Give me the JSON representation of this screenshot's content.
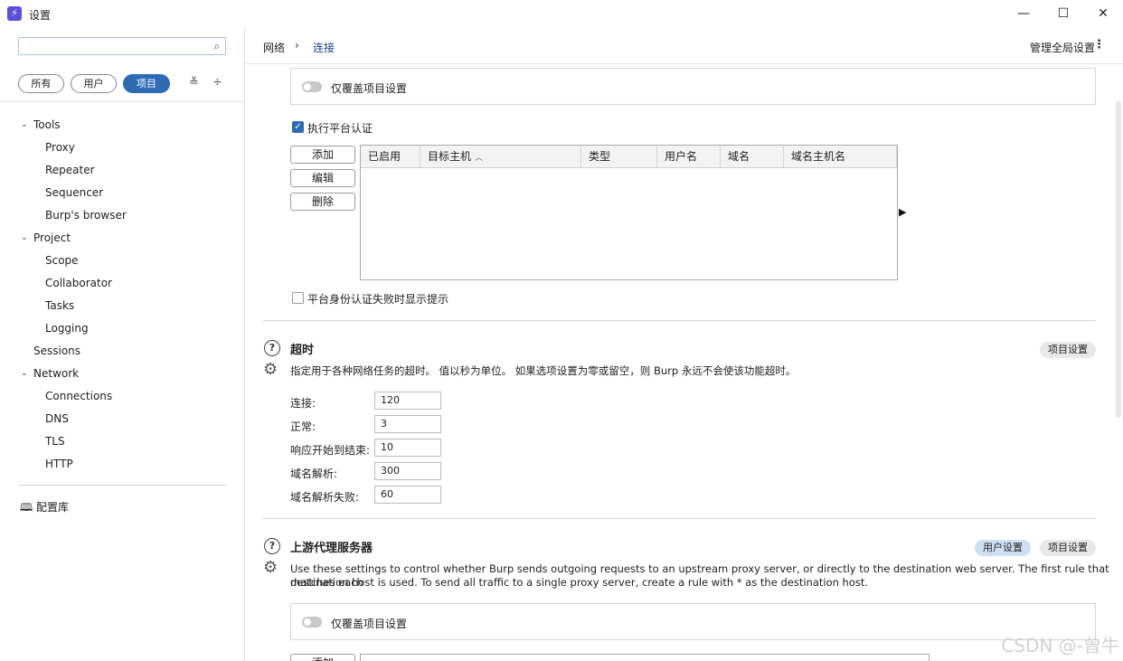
{
  "window": {
    "title": "设置",
    "app_icon": "burp-icon",
    "minimize": "—",
    "maximize": "☐",
    "close": "✕"
  },
  "sidebar": {
    "search": {
      "placeholder": "",
      "icon": "search-icon"
    },
    "filters": [
      {
        "label": "所有",
        "active": false
      },
      {
        "label": "用户",
        "active": false
      },
      {
        "label": "项目",
        "active": true
      }
    ],
    "tree": [
      {
        "label": "Tools",
        "level": 0,
        "expanded": true
      },
      {
        "label": "Proxy",
        "level": 1
      },
      {
        "label": "Repeater",
        "level": 1
      },
      {
        "label": "Sequencer",
        "level": 1
      },
      {
        "label": "Burp's browser",
        "level": 1
      },
      {
        "label": "Project",
        "level": 0,
        "expanded": true
      },
      {
        "label": "Scope",
        "level": 1
      },
      {
        "label": "Collaborator",
        "level": 1
      },
      {
        "label": "Tasks",
        "level": 1
      },
      {
        "label": "Logging",
        "level": 1
      },
      {
        "label": "Sessions",
        "level": 0
      },
      {
        "label": "Network",
        "level": 0,
        "expanded": true
      },
      {
        "label": "Connections",
        "level": 1
      },
      {
        "label": "DNS",
        "level": 1
      },
      {
        "label": "TLS",
        "level": 1
      },
      {
        "label": "HTTP",
        "level": 1
      }
    ],
    "library": "配置库"
  },
  "header": {
    "breadcrumb": [
      "网络",
      "连接"
    ],
    "global_settings": "管理全局设置"
  },
  "platform_auth": {
    "override_toggle_label": "仅覆盖项目设置",
    "enable_checkbox_label": "执行平台认证",
    "enable_checked": true,
    "buttons": {
      "add": "添加",
      "edit": "编辑",
      "remove": "删除"
    },
    "columns": [
      "已启用",
      "目标主机",
      "类型",
      "用户名",
      "域名",
      "域名主机名"
    ],
    "prompt_checkbox_label": "平台身份认证失败时显示提示",
    "prompt_checked": false
  },
  "timeouts": {
    "title": "超时",
    "badge": "项目设置",
    "description": "指定用于各种网络任务的超时。 值以秒为单位。 如果选项设置为零或留空，则 Burp 永远不会使该功能超时。",
    "fields": [
      {
        "label": "连接:",
        "value": "120"
      },
      {
        "label": "正常:",
        "value": "3"
      },
      {
        "label": "响应开始到结束:",
        "value": "10"
      },
      {
        "label": "域名解析:",
        "value": "300"
      },
      {
        "label": "域名解析失败:",
        "value": "60"
      }
    ]
  },
  "upstream": {
    "title": "上游代理服务器",
    "badge_user": "用户设置",
    "badge_project": "项目设置",
    "description_line1": "Use these settings to control whether Burp sends outgoing requests to an upstream proxy server, or directly to the destination web server. The first rule that matches each",
    "description_line2": "destination host is used. To send all traffic to a single proxy server, create a rule with * as the destination host.",
    "override_toggle_label": "仅覆盖项目设置",
    "add_button": "添加"
  },
  "watermark": "CSDN @-曾牛"
}
